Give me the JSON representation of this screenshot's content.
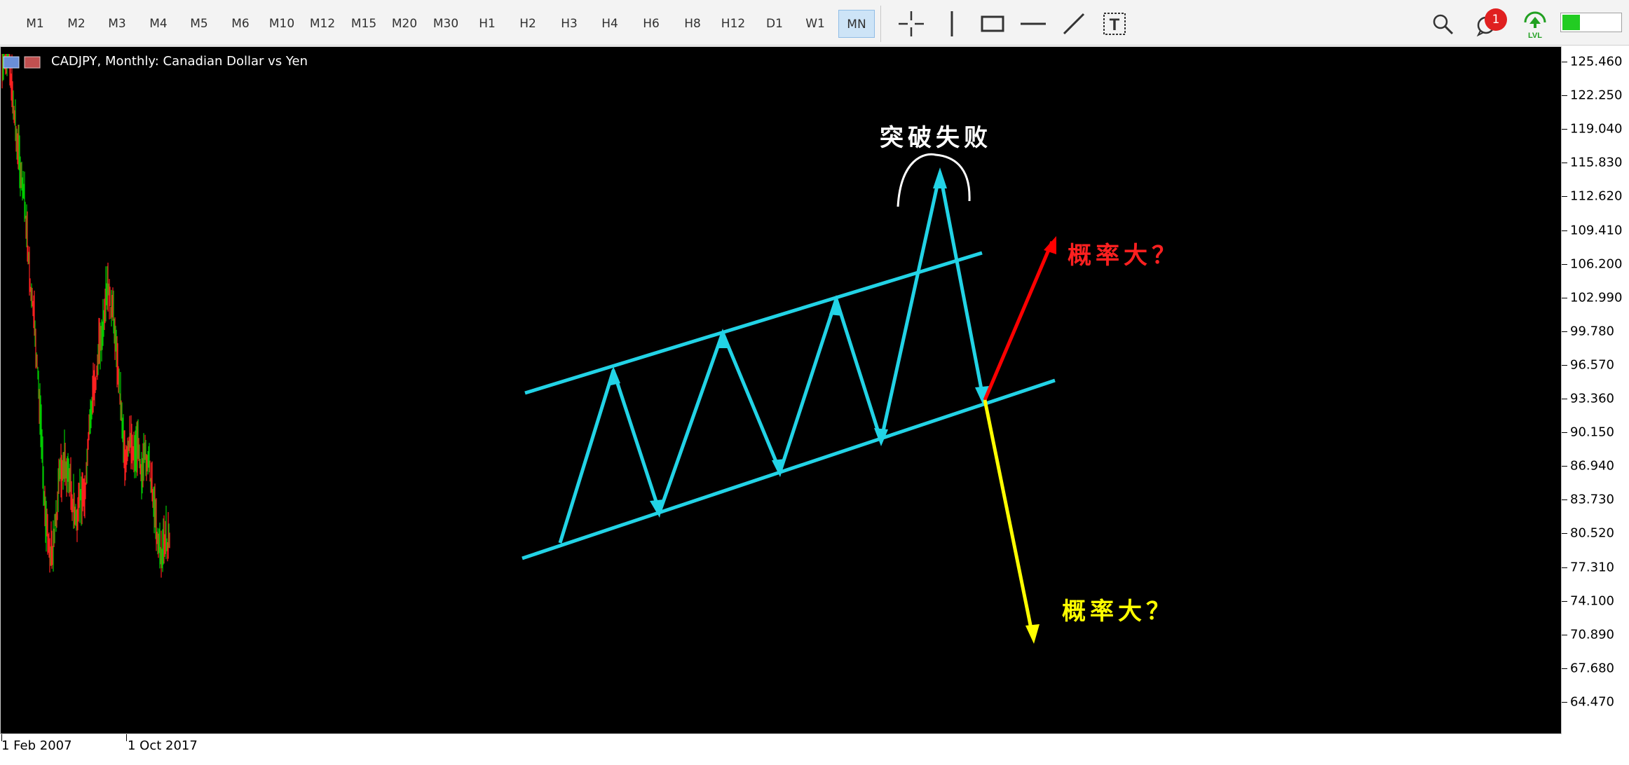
{
  "toolbar": {
    "timeframes": [
      "M1",
      "M2",
      "M3",
      "M4",
      "M5",
      "M6",
      "M10",
      "M12",
      "M15",
      "M20",
      "M30",
      "H1",
      "H2",
      "H3",
      "H4",
      "H6",
      "H8",
      "H12",
      "D1",
      "W1",
      "MN"
    ],
    "active_timeframe": "MN",
    "tools": [
      "crosshair-icon",
      "vertical-line-icon",
      "rectangle-icon",
      "horizontal-line-icon",
      "trendline-icon",
      "text-icon"
    ],
    "notification_count": "1",
    "lvl_label": "LVL",
    "level_fill": 0.3
  },
  "chart": {
    "title": "CADJPY, Monthly:  Canadian Dollar vs Yen",
    "annotations": {
      "breakout_failed": "突破失败",
      "probability_up": "概率大？",
      "probability_down": "概率大？"
    },
    "colors": {
      "channel": "#22d3e6",
      "up_arrow": "#ff0000",
      "down_arrow": "#ffff00",
      "bull_candle": "#00cc00",
      "bear_candle": "#ff2020",
      "annotation_white": "#ffffff"
    }
  },
  "price_axis": {
    "labels": [
      "125.460",
      "122.250",
      "119.040",
      "115.830",
      "112.620",
      "109.410",
      "106.200",
      "102.990",
      "99.780",
      "96.570",
      "93.360",
      "90.150",
      "86.940",
      "83.730",
      "80.520",
      "77.310",
      "74.100",
      "70.890",
      "67.680",
      "64.470"
    ]
  },
  "time_axis": {
    "labels": [
      "1 Feb 2007",
      "1 Oct 2017"
    ]
  }
}
